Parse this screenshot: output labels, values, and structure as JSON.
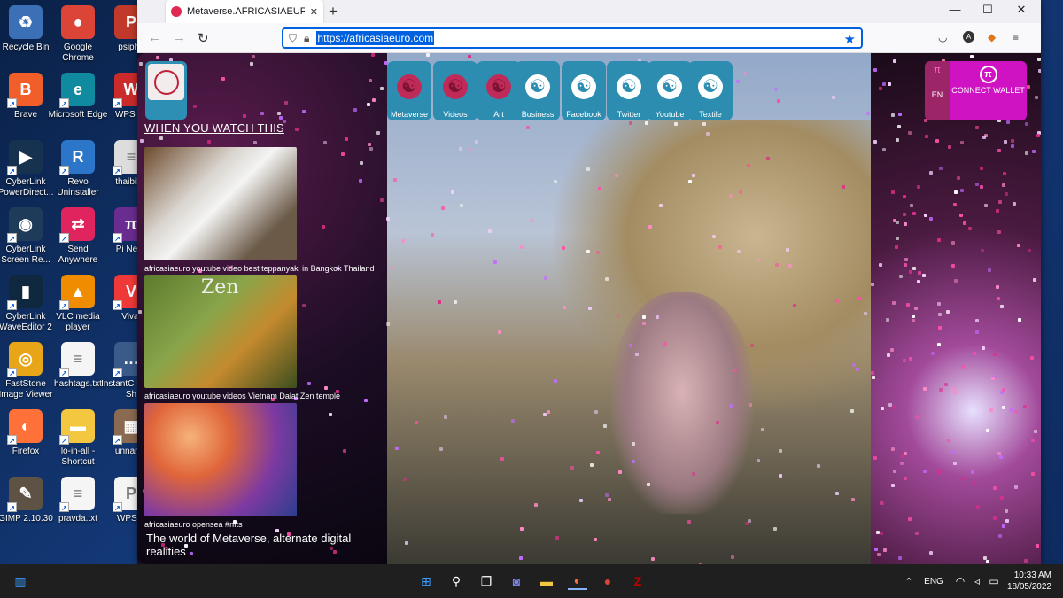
{
  "desktop": {
    "icons": [
      {
        "label": "Recycle Bin",
        "glyph": "♻",
        "color": "#3b6fb6"
      },
      {
        "label": "Google Chrome",
        "glyph": "●",
        "color": "#db4437"
      },
      {
        "label": "psipho",
        "glyph": "P",
        "color": "#c0392b"
      },
      {
        "label": "Brave",
        "glyph": "B",
        "color": "#f25e2a"
      },
      {
        "label": "Microsoft Edge",
        "glyph": "e",
        "color": "#0f8a9e"
      },
      {
        "label": "WPS Of",
        "glyph": "W",
        "color": "#cc2b2b"
      },
      {
        "label": "CyberLink PowerDirect...",
        "glyph": "▶",
        "color": "#17324f"
      },
      {
        "label": "Revo Uninstaller",
        "glyph": "R",
        "color": "#2b76c9"
      },
      {
        "label": "thaibillic",
        "glyph": "≡",
        "color": "#dddddd"
      },
      {
        "label": "CyberLink Screen Re...",
        "glyph": "◉",
        "color": "#1e3c5a"
      },
      {
        "label": "Send Anywhere",
        "glyph": "⇄",
        "color": "#e0245e"
      },
      {
        "label": "Pi Netw",
        "glyph": "π",
        "color": "#6b2c91"
      },
      {
        "label": "CyberLink WaveEditor 2",
        "glyph": "▮",
        "color": "#10283f"
      },
      {
        "label": "VLC media player",
        "glyph": "▲",
        "color": "#f08c00"
      },
      {
        "label": "Vival",
        "glyph": "V",
        "color": "#ef3939"
      },
      {
        "label": "FastStone Image Viewer",
        "glyph": "◎",
        "color": "#e8a518"
      },
      {
        "label": "hashtags.txt",
        "glyph": "≡",
        "color": "#f5f5f5"
      },
      {
        "label": "InstantC PRO - Sh",
        "glyph": "…",
        "color": "#3a5a8a"
      },
      {
        "label": "Firefox",
        "glyph": "◐",
        "color": "#ff7139"
      },
      {
        "label": "lo-in-all - Shortcut",
        "glyph": "▬",
        "color": "#f3c740"
      },
      {
        "label": "unname",
        "glyph": "▦",
        "color": "#8a6a50"
      },
      {
        "label": "GIMP 2.10.30",
        "glyph": "✎",
        "color": "#5e5244"
      },
      {
        "label": "pravda.txt",
        "glyph": "≡",
        "color": "#f5f5f5"
      },
      {
        "label": "WPS P",
        "glyph": "P",
        "color": "#f5f5f5"
      }
    ]
  },
  "browser": {
    "tab_title": "Metaverse.AFRICASIAEURO | NF",
    "tab_close": "✕",
    "new_tab": "+",
    "window_controls": {
      "minimize": "—",
      "maximize": "☐",
      "close": "✕"
    },
    "url": "https://africasiaeuro.com",
    "nav": {
      "back": "←",
      "forward": "→",
      "reload": "↻"
    }
  },
  "page": {
    "watch_title": "WHEN YOU WATCH THIS",
    "videos": [
      {
        "caption": "africasiaeuro youtube video best teppanyaki in Bangkok Thailand"
      },
      {
        "caption": "africasiaeuro youtube videos Vietnam Dalat Zen temple",
        "overlay": "Zen"
      },
      {
        "caption": "africasiaeuro opensea #nfts"
      }
    ],
    "metaverse_text": "The world of Metaverse, alternate digital realities",
    "nav_icons": [
      {
        "label": "Metaverse",
        "style": "pink"
      },
      {
        "label": "Videos",
        "style": "pink"
      },
      {
        "label": "Art",
        "style": "pink"
      },
      {
        "label": "Business",
        "style": "white"
      },
      {
        "label": "Facebook",
        "style": "white"
      },
      {
        "label": "Twitter",
        "style": "white"
      },
      {
        "label": "Youtube",
        "style": "white"
      },
      {
        "label": "Textile",
        "style": "white"
      }
    ],
    "lang": "EN",
    "wallet": "CONNECT WALLET"
  },
  "taskbar": {
    "lang": "ENG",
    "time": "10:33 AM",
    "date": "18/05/2022"
  }
}
